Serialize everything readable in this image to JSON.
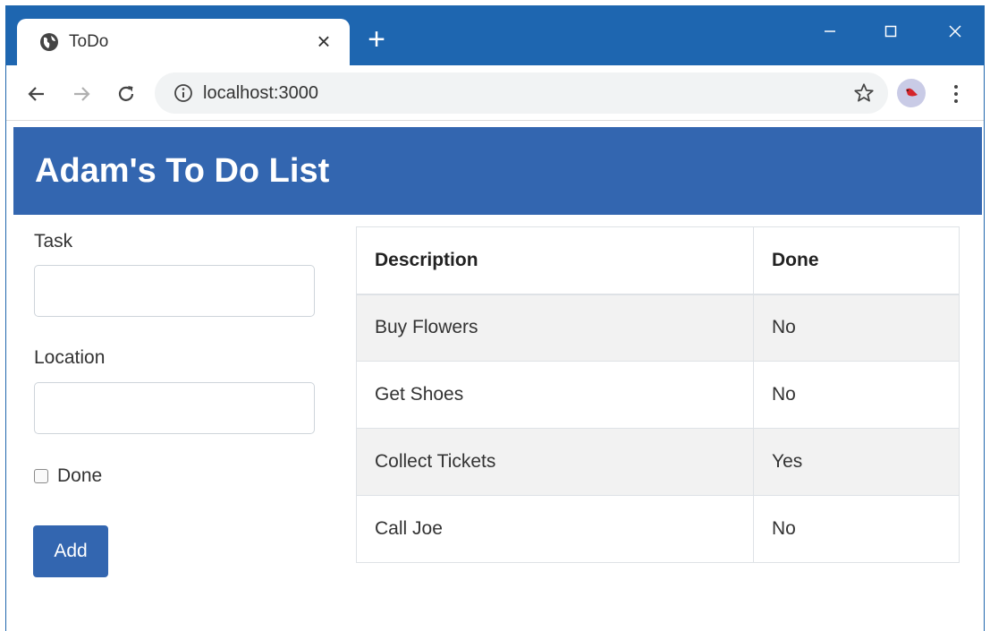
{
  "browser": {
    "tab_title": "ToDo",
    "tab_close": "×",
    "new_tab": "+",
    "url": "localhost:3000"
  },
  "page": {
    "heading": "Adam's To Do List",
    "form": {
      "task_label": "Task",
      "task_value": "",
      "location_label": "Location",
      "location_value": "",
      "done_label": "Done",
      "add_label": "Add"
    },
    "table": {
      "headers": [
        "Description",
        "Done"
      ],
      "rows": [
        [
          "Buy Flowers",
          "No"
        ],
        [
          "Get Shoes",
          "No"
        ],
        [
          "Collect Tickets",
          "Yes"
        ],
        [
          "Call Joe",
          "No"
        ]
      ]
    }
  },
  "colors": {
    "titlebar": "#1e66b0",
    "header": "#3366b0",
    "button": "#3366b0"
  }
}
